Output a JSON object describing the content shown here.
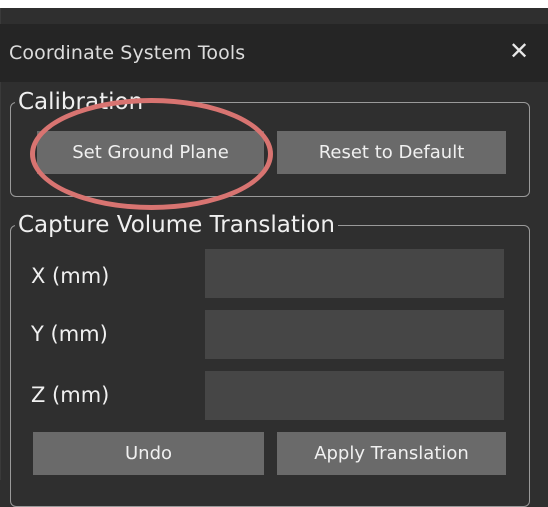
{
  "window": {
    "title": "Coordinate System Tools",
    "close_icon": "close-icon"
  },
  "calibration": {
    "legend": "Calibration",
    "set_ground_plane_label": "Set Ground Plane",
    "reset_default_label": "Reset to Default"
  },
  "capture_volume": {
    "legend": "Capture Volume Translation",
    "x_label": "X (mm)",
    "y_label": "Y (mm)",
    "z_label": "Z (mm)",
    "x_value": "",
    "y_value": "",
    "z_value": "",
    "undo_label": "Undo",
    "apply_label": "Apply Translation"
  },
  "colors": {
    "panel_bg": "#2f2f2f",
    "titlebar_bg": "#252525",
    "button_bg": "#6a6a6a",
    "field_bg": "#464646",
    "annotation": "#d87471"
  }
}
